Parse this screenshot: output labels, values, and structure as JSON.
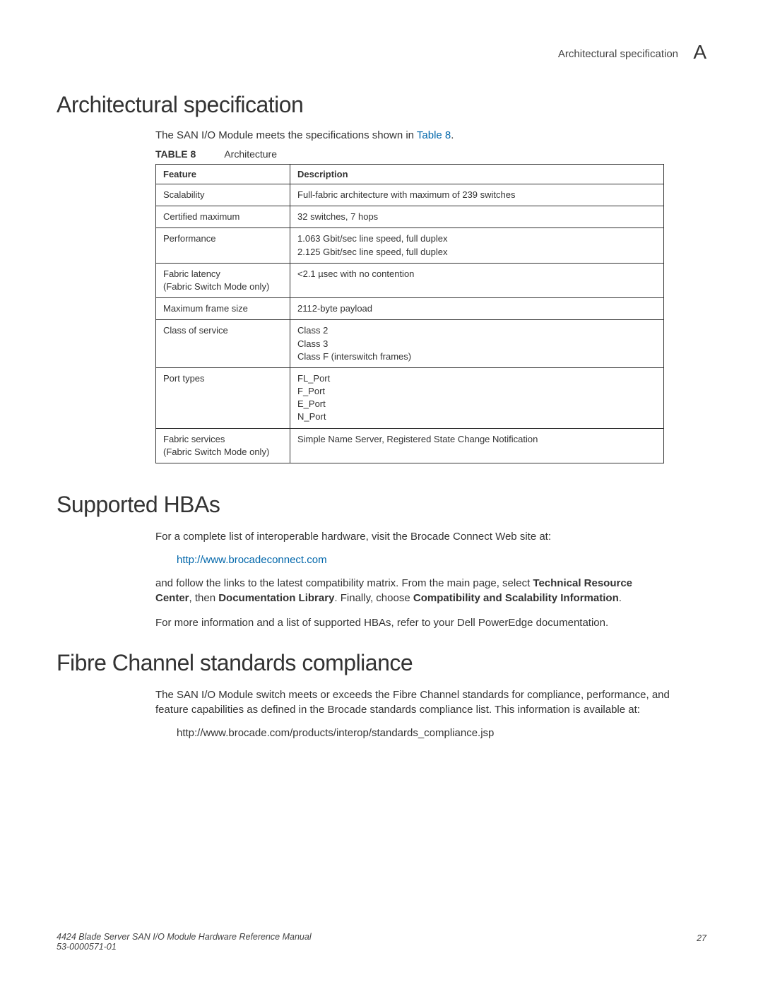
{
  "header": {
    "label": "Architectural specification",
    "letter": "A"
  },
  "section1": {
    "heading": "Architectural specification",
    "intro_prefix": "The SAN I/O Module meets the specifications shown in ",
    "intro_link": "Table 8",
    "intro_suffix": ".",
    "table_label": "TABLE 8",
    "table_title": "Architecture",
    "col1": "Feature",
    "col2": "Description",
    "rows": [
      {
        "feature": [
          "Scalability"
        ],
        "desc": [
          "Full-fabric architecture with maximum of 239 switches"
        ]
      },
      {
        "feature": [
          "Certified maximum"
        ],
        "desc": [
          "32 switches, 7 hops"
        ]
      },
      {
        "feature": [
          "Performance"
        ],
        "desc": [
          "1.063 Gbit/sec line speed, full duplex",
          "2.125 Gbit/sec line speed, full duplex"
        ]
      },
      {
        "feature": [
          "Fabric latency",
          "(Fabric Switch Mode only)"
        ],
        "desc": [
          "<2.1 µsec with no contention"
        ]
      },
      {
        "feature": [
          "Maximum frame size"
        ],
        "desc": [
          "2112-byte payload"
        ]
      },
      {
        "feature": [
          "Class of service"
        ],
        "desc": [
          "Class 2",
          "Class 3",
          "Class F (interswitch frames)"
        ]
      },
      {
        "feature": [
          "Port types"
        ],
        "desc": [
          "FL_Port",
          "F_Port",
          "E_Port",
          "N_Port"
        ]
      },
      {
        "feature": [
          "Fabric services",
          "(Fabric Switch Mode only)"
        ],
        "desc": [
          "Simple Name Server, Registered State Change Notification"
        ]
      }
    ]
  },
  "section2": {
    "heading": "Supported HBAs",
    "p1": "For a complete list of interoperable hardware, visit the Brocade Connect Web site at:",
    "link": "http://www.brocadeconnect.com",
    "p2_a": "and follow the links to the latest compatibility matrix. From the main page, select ",
    "p2_b1": "Technical Resource Center",
    "p2_c": ", then ",
    "p2_b2": "Documentation Library",
    "p2_d": ". Finally, choose ",
    "p2_b3": "Compatibility and Scalability Information",
    "p2_e": ".",
    "p3": "For more information and a list of supported HBAs, refer to your Dell PowerEdge documentation."
  },
  "section3": {
    "heading": "Fibre Channel standards compliance",
    "p1": "The SAN I/O Module switch meets or exceeds the Fibre Channel standards for compliance, performance, and feature capabilities as defined in the Brocade standards compliance list. This information is available at:",
    "url": "http://www.brocade.com/products/interop/standards_compliance.jsp"
  },
  "footer": {
    "left1": "4424 Blade Server SAN I/O Module Hardware Reference Manual",
    "left2": "53-0000571-01",
    "right": "27"
  }
}
